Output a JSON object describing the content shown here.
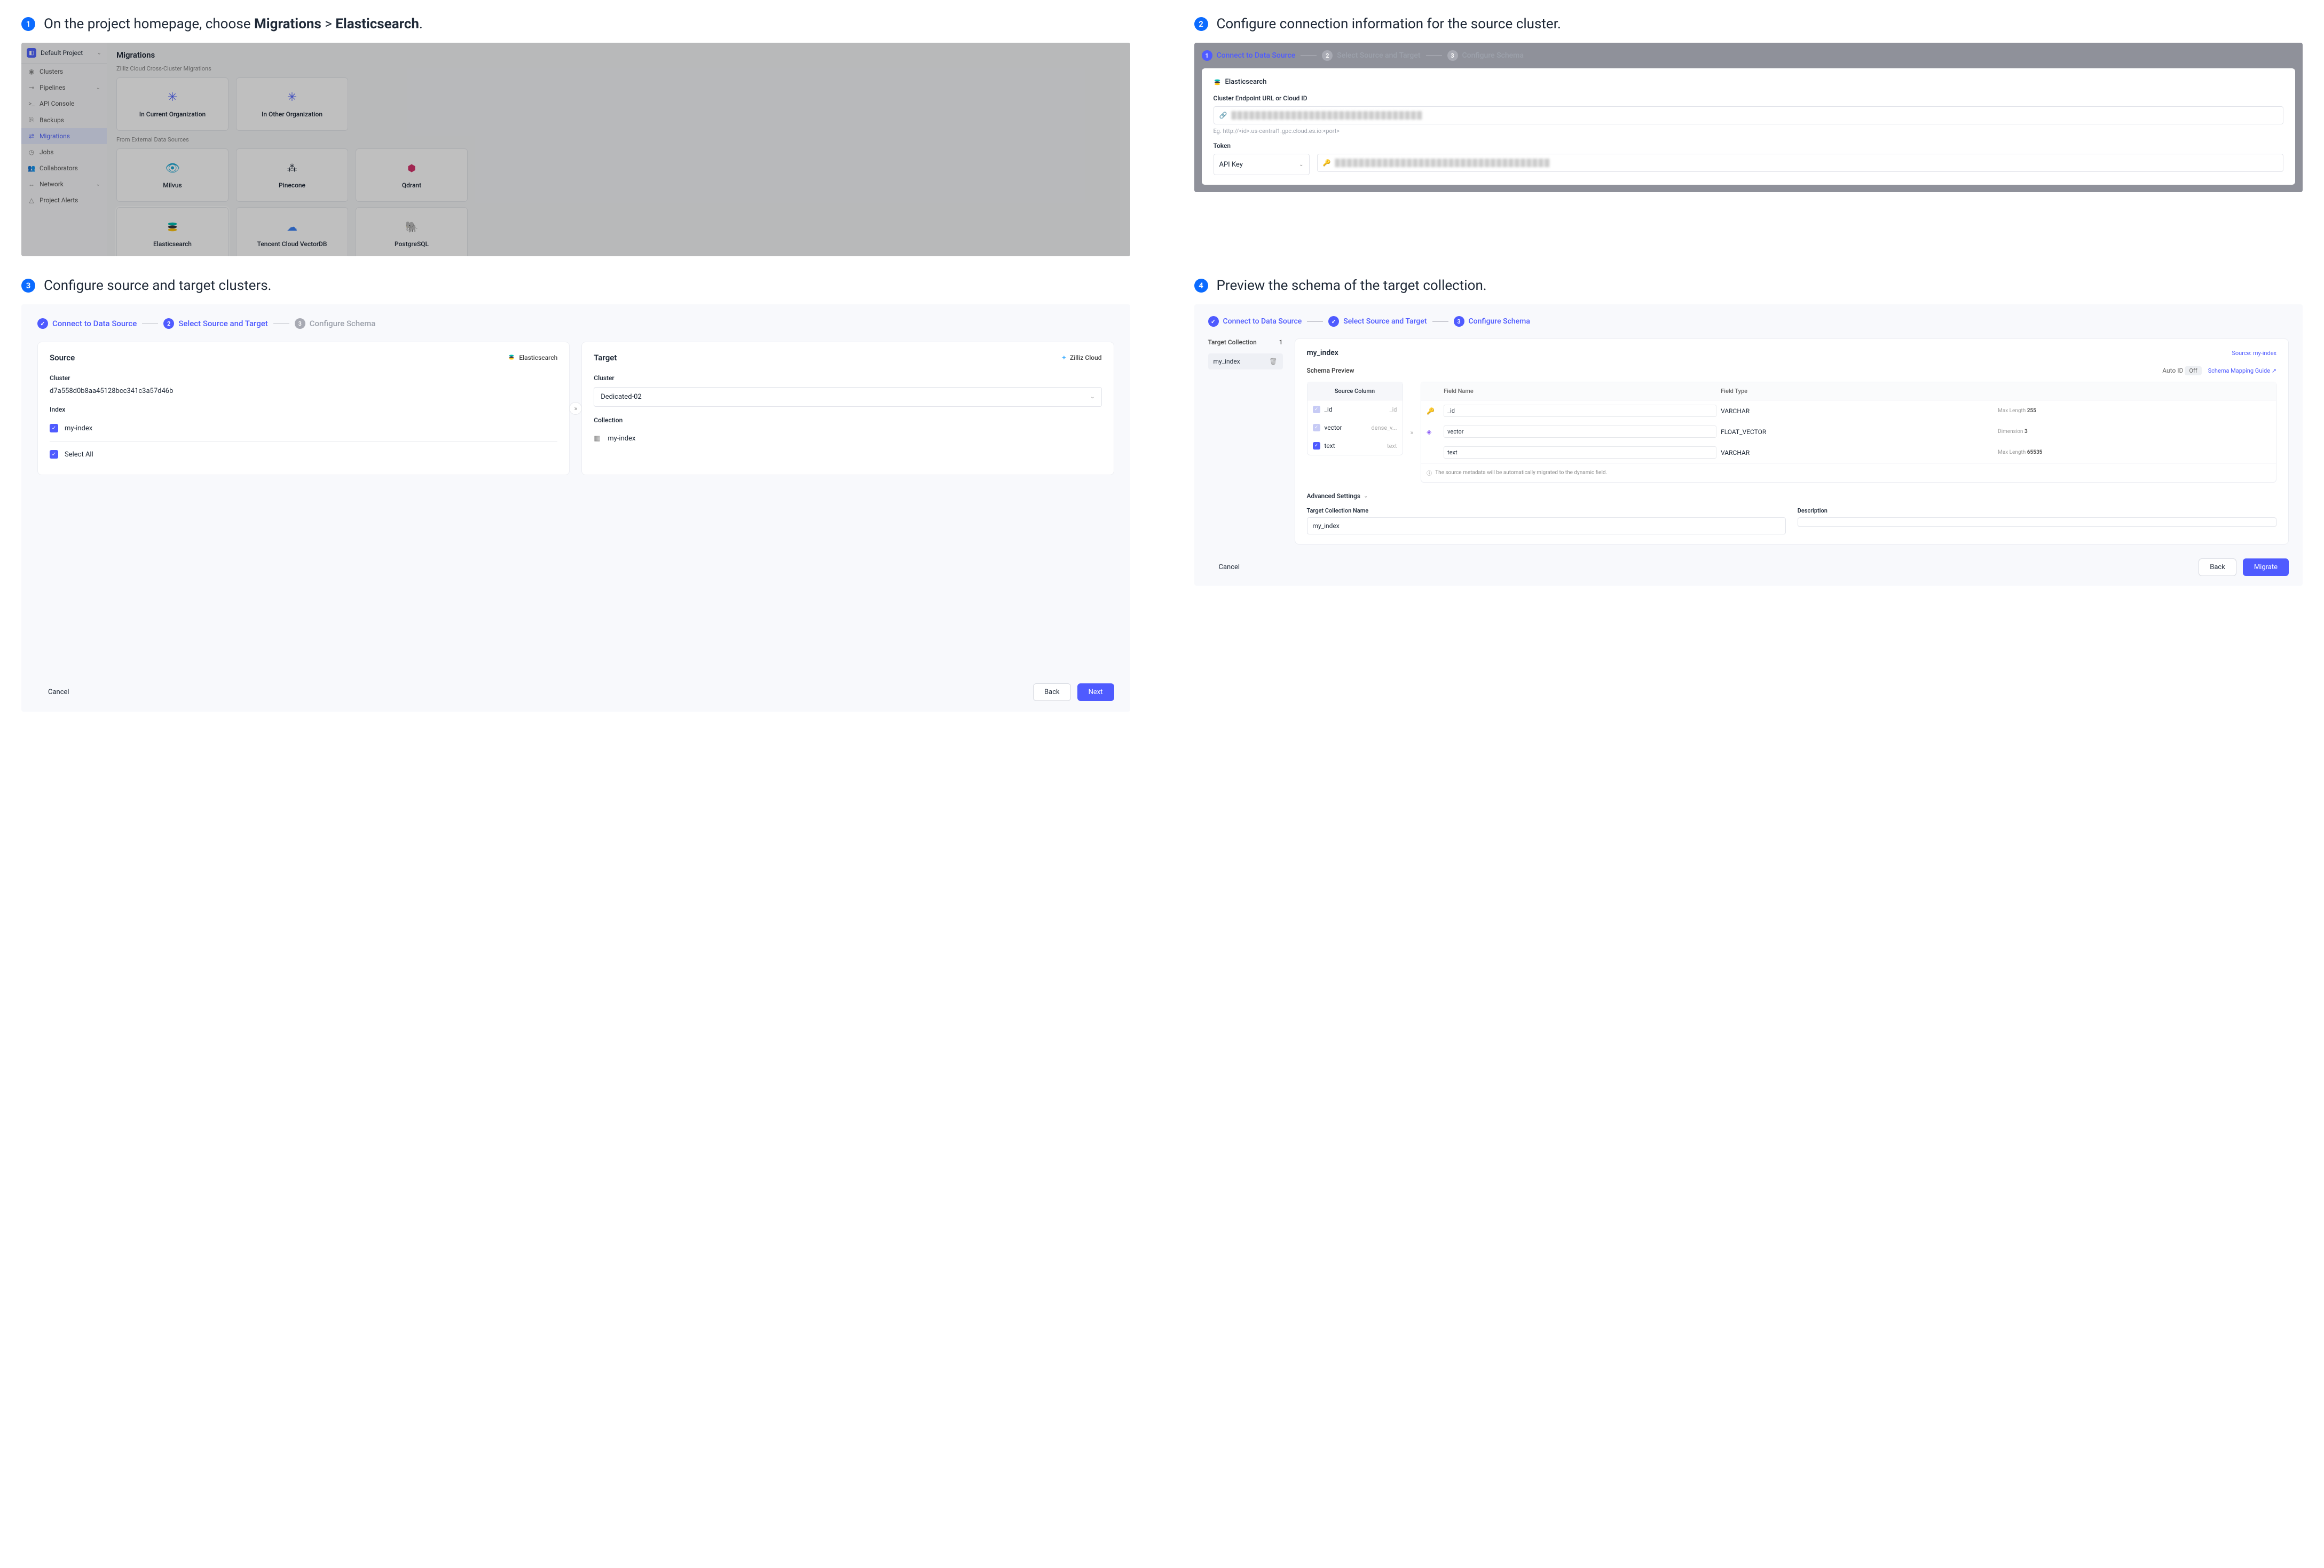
{
  "step1": {
    "heading_prefix": "On the project homepage, choose ",
    "heading_bold1": "Migrations",
    "heading_sep": " > ",
    "heading_bold2": "Elasticsearch",
    "heading_suffix": ".",
    "project_label": "Default Project",
    "nav": {
      "clusters": "Clusters",
      "pipelines": "Pipelines",
      "api_console": "API Console",
      "backups": "Backups",
      "migrations": "Migrations",
      "jobs": "Jobs",
      "collaborators": "Collaborators",
      "network": "Network",
      "project_alerts": "Project Alerts"
    },
    "main_title": "Migrations",
    "section_cross": "Zilliz Cloud Cross-Cluster Migrations",
    "section_ext": "From External Data Sources",
    "cards": {
      "in_org": "In Current Organization",
      "other_org": "In Other Organization",
      "milvus": "Milvus",
      "pinecone": "Pinecone",
      "qdrant": "Qdrant",
      "elasticsearch": "Elasticsearch",
      "tencent": "Tencent Cloud VectorDB",
      "postgres": "PostgreSQL"
    }
  },
  "step2": {
    "heading": "Configure connection information for the source cluster.",
    "wizard": {
      "s1": "Connect to Data Source",
      "s2": "Select Source and Target",
      "s3": "Configure Schema"
    },
    "source_name": "Elasticsearch",
    "endpoint_label": "Cluster Endpoint URL or Cloud ID",
    "hint": "Eg. http://<id>.us-central1.gpc.cloud.es.io:<port>",
    "token_label": "Token",
    "token_select": "API Key"
  },
  "step3": {
    "heading": "Configure source and target clusters.",
    "wizard": {
      "s1": "Connect to Data Source",
      "s2": "Select Source and Target",
      "s3": "Configure Schema"
    },
    "source_title": "Source",
    "source_tag": "Elasticsearch",
    "cluster_label": "Cluster",
    "cluster_value": "d7a558d0b8aa45128bcc341c3a57d46b",
    "index_label": "Index",
    "index_item": "my-index",
    "select_all": "Select All",
    "target_title": "Target",
    "target_tag": "Zilliz Cloud",
    "target_cluster_label": "Cluster",
    "target_cluster_value": "Dedicated-02",
    "collection_label": "Collection",
    "collection_value": "my-index",
    "cancel": "Cancel",
    "back": "Back",
    "next": "Next"
  },
  "step4": {
    "heading": "Preview the schema of the target collection.",
    "wizard": {
      "s1": "Connect to Data Source",
      "s2": "Select Source and Target",
      "s3": "Configure Schema"
    },
    "tc_label": "Target Collection",
    "tc_count": "1",
    "tc_item": "my_index",
    "right_title": "my_index",
    "source_ref": "Source: my-index",
    "schema_preview": "Schema Preview",
    "auto_id_label": "Auto ID",
    "auto_id_value": "Off",
    "mapping_guide": "Schema Mapping Guide",
    "src_col_head": "Source Column",
    "src_rows": [
      {
        "name": "_id",
        "tag": "_id"
      },
      {
        "name": "vector",
        "tag": "dense_v..."
      },
      {
        "name": "text",
        "tag": "text"
      }
    ],
    "tgt_head": {
      "name": "Field Name",
      "type": "Field Type"
    },
    "tgt_rows": [
      {
        "icon": "key",
        "name": "_id",
        "type": "VARCHAR",
        "meta_label": "Max Length",
        "meta_val": "255"
      },
      {
        "icon": "vec",
        "name": "vector",
        "type": "FLOAT_VECTOR",
        "meta_label": "Dimension",
        "meta_val": "3"
      },
      {
        "icon": "",
        "name": "text",
        "type": "VARCHAR",
        "meta_label": "Max Length",
        "meta_val": "65535"
      }
    ],
    "note": "The source metadata will be automatically migrated to the dynamic field.",
    "adv": "Advanced Settings",
    "tcn_label": "Target Collection Name",
    "tcn_value": "my_index",
    "desc_label": "Description",
    "cancel": "Cancel",
    "back": "Back",
    "migrate": "Migrate"
  }
}
